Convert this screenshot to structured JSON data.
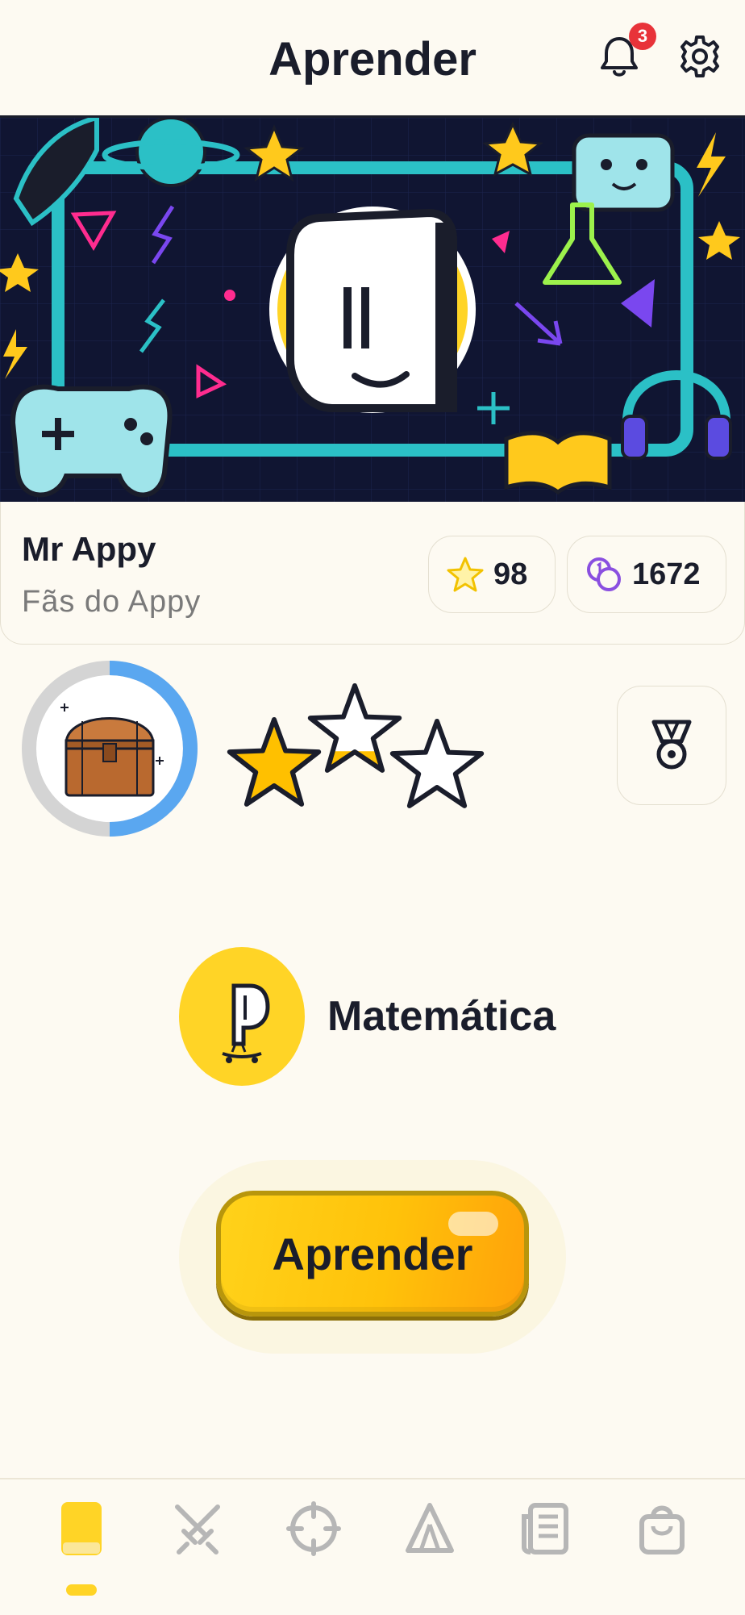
{
  "header": {
    "title": "Aprender",
    "notification_count": "3"
  },
  "profile": {
    "name": "Mr Appy",
    "group": "Fãs do Appy",
    "stars": "98",
    "coins": "1672"
  },
  "progress": {
    "chest_ring_fraction": 0.5,
    "stars_filled": [
      1,
      0.3,
      0
    ]
  },
  "subject": {
    "name": "Matemática"
  },
  "actions": {
    "learn_label": "Aprender"
  },
  "nav": {
    "items": [
      "book-icon",
      "swords-icon",
      "crosshair-icon",
      "tent-icon",
      "news-icon",
      "shop-bag-icon"
    ],
    "active_index": 0
  },
  "colors": {
    "accent": "#ffd426",
    "ring_progress": "#5aa7f0",
    "badge": "#e8333a"
  }
}
